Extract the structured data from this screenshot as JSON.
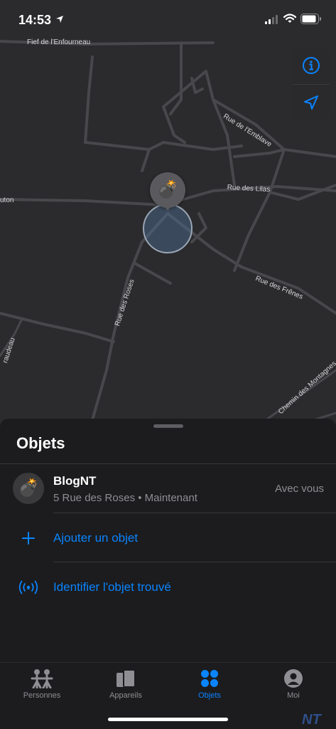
{
  "status_bar": {
    "time": "14:53"
  },
  "map": {
    "streets": [
      "Fief de l'Enfourneau",
      "Rue de l'Emblave",
      "Rue des Lilas",
      "uton",
      "Rue des Frênes",
      "Rue des Roses",
      "raudeau",
      "Chemin des Montagnes"
    ],
    "item_emoji": "💣"
  },
  "sheet": {
    "title": "Objets",
    "item": {
      "emoji": "💣",
      "name": "BlogNT",
      "subtitle": "5 Rue des Roses • Maintenant",
      "status": "Avec vous"
    },
    "add_label": "Ajouter un objet",
    "identify_label": "Identifier l'objet trouvé"
  },
  "tabs": [
    {
      "label": "Personnes",
      "icon": "people-icon"
    },
    {
      "label": "Appareils",
      "icon": "devices-icon"
    },
    {
      "label": "Objets",
      "icon": "items-icon",
      "active": true
    },
    {
      "label": "Moi",
      "icon": "person-circle-icon"
    }
  ],
  "watermark": "NT",
  "colors": {
    "accent": "#0a84ff",
    "map_bg": "#2b2b2d",
    "sheet_bg": "#1c1c1e"
  }
}
